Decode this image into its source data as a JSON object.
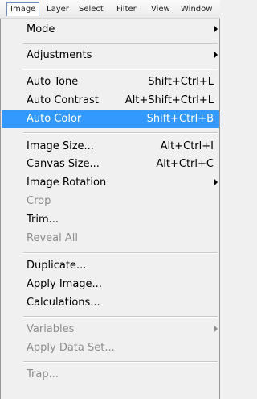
{
  "menubar": {
    "items": [
      "Image",
      "Layer",
      "Select",
      "Filter",
      "View",
      "Window"
    ]
  },
  "menu": {
    "items": [
      {
        "label": "Mode",
        "submenu": true
      },
      {
        "label": "Adjustments",
        "submenu": true
      },
      {
        "label": "Auto Tone",
        "shortcut": "Shift+Ctrl+L"
      },
      {
        "label": "Auto Contrast",
        "shortcut": "Alt+Shift+Ctrl+L"
      },
      {
        "label": "Auto Color",
        "shortcut": "Shift+Ctrl+B",
        "selected": true
      },
      {
        "label": "Image Size...",
        "shortcut": "Alt+Ctrl+I"
      },
      {
        "label": "Canvas Size...",
        "shortcut": "Alt+Ctrl+C"
      },
      {
        "label": "Image Rotation",
        "submenu": true
      },
      {
        "label": "Crop",
        "disabled": true
      },
      {
        "label": "Trim..."
      },
      {
        "label": "Reveal All",
        "disabled": true
      },
      {
        "label": "Duplicate..."
      },
      {
        "label": "Apply Image..."
      },
      {
        "label": "Calculations..."
      },
      {
        "label": "Variables",
        "disabled": true,
        "submenu": true
      },
      {
        "label": "Apply Data Set...",
        "disabled": true
      },
      {
        "label": "Trap...",
        "disabled": true
      }
    ]
  }
}
